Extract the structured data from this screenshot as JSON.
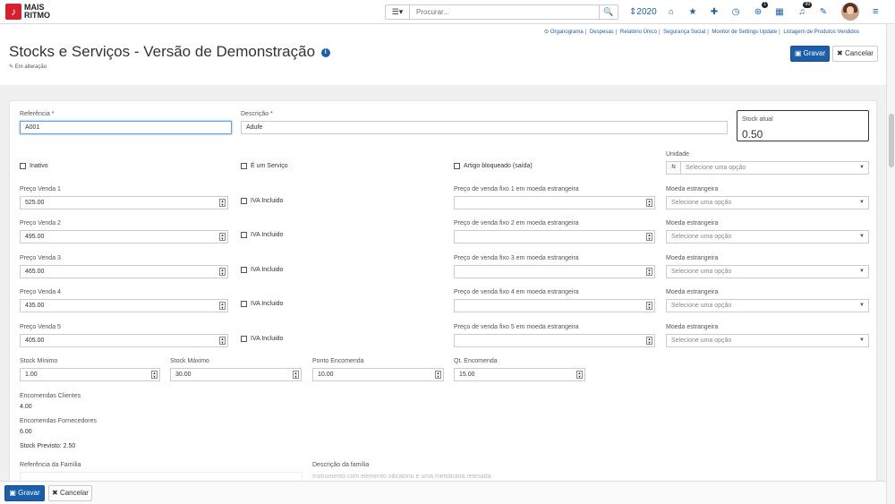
{
  "brand": {
    "line1": "MAIS",
    "line2": "RITMO",
    "logo_glyph": "♪"
  },
  "search": {
    "placeholder": "Procurar...",
    "menu_icon": "☰▾",
    "search_icon": "🔍"
  },
  "nav": {
    "year": "⇕2020",
    "icons": [
      {
        "name": "home-icon",
        "glyph": "⌂"
      },
      {
        "name": "star-icon",
        "glyph": "★"
      },
      {
        "name": "plus-icon",
        "glyph": "✚"
      },
      {
        "name": "clock-icon",
        "glyph": "◷"
      },
      {
        "name": "tags-icon",
        "glyph": "⊛",
        "badge": "1"
      },
      {
        "name": "calendar-icon",
        "glyph": "▦"
      },
      {
        "name": "bell-icon",
        "glyph": "♫",
        "badge": "99"
      },
      {
        "name": "wrench-icon",
        "glyph": "✎"
      }
    ],
    "hamburger": "≡"
  },
  "links": [
    "Organograma",
    "Despesas",
    "Relatório Único",
    "Segurança Social",
    "Monitor de Settings Update",
    "Listagem de Produtos Vendidos"
  ],
  "links_separator": "|",
  "links_icon": "⊙",
  "page": {
    "title": "Stocks e Serviços - Versão de Demonstração",
    "info_icon": "i",
    "status": "Em alteração",
    "status_icon": "✎"
  },
  "actions": {
    "save": "Gravar",
    "cancel": "Cancelar",
    "save_icon": "▣",
    "cancel_icon": "✖"
  },
  "form": {
    "referencia_label": "Referência *",
    "referencia_value": "A001",
    "descricao_label": "Descrição *",
    "descricao_value": "Adufe",
    "stock_atual_label": "Stock atual",
    "stock_atual_value": "0.50",
    "inativo": "Inativo",
    "servico": "É um Serviço",
    "bloqueado": "Artigo bloqueado (saída)",
    "unidade_label": "Unidade",
    "unidade_prefix": "N",
    "select_placeholder": "Selecione uma opção",
    "iva": "IVA Incluido",
    "moeda_label": "Moeda estrangeira",
    "precos": [
      {
        "label": "Preço Venda 1",
        "value": "525.00",
        "fixo_label": "Preço de venda fixo 1 em moeda estrangeira"
      },
      {
        "label": "Preço Venda 2",
        "value": "495.00",
        "fixo_label": "Preço de venda fixo 2 em moeda estrangeira"
      },
      {
        "label": "Preço Venda 3",
        "value": "465.00",
        "fixo_label": "Preço de venda fixo 3 em moeda estrangeira"
      },
      {
        "label": "Preço Venda 4",
        "value": "435.00",
        "fixo_label": "Preço de venda fixo 4 em moeda estrangeira"
      },
      {
        "label": "Preço Venda 5",
        "value": "405.00",
        "fixo_label": "Preço de venda fixo 5 em moeda estrangeira"
      }
    ],
    "stock_minimo_label": "Stock Mínimo",
    "stock_minimo_value": "1.00",
    "stock_maximo_label": "Stock Máximo",
    "stock_maximo_value": "30.00",
    "ponto_encomenda_label": "Ponto Encomenda",
    "ponto_encomenda_value": "10.00",
    "qt_encomenda_label": "Qt. Encomenda",
    "qt_encomenda_value": "15.00",
    "enc_clientes_label": "Encomendas Clientes",
    "enc_clientes_value": "4.00",
    "enc_fornecedores_label": "Encomendas Fornecedores",
    "enc_fornecedores_value": "6.00",
    "stock_previsto": "Stock Previsto: 2.50",
    "ref_familia_label": "Referência da Família",
    "desc_familia_label": "Descrição da família",
    "desc_familia_value": "Instrumento com elemento vibratório é uma membrana retesada"
  }
}
